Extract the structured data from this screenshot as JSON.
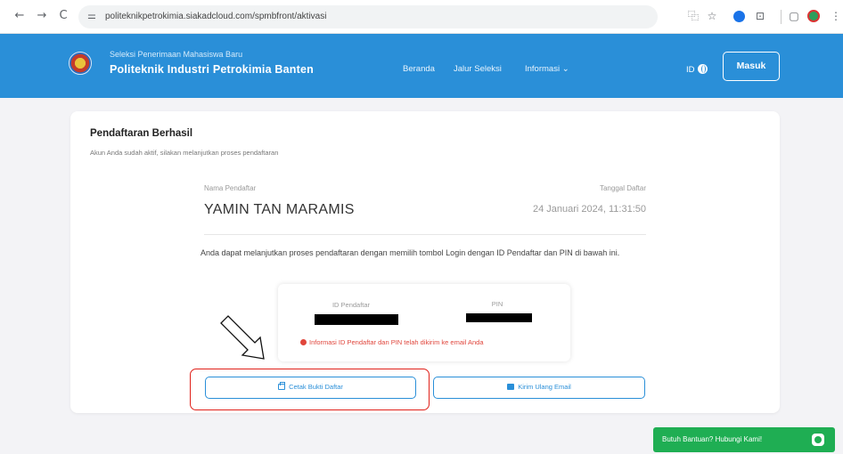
{
  "browser": {
    "url": "politeknikpetrokimia.siakadcloud.com/spmbfront/aktivasi",
    "nav": {
      "back": "←",
      "forward": "→",
      "reload": "C",
      "site_info": "⚌"
    },
    "toolbar": {
      "translate": "⿻",
      "star": "☆",
      "extensions": "⊡",
      "sidepanel": "▢",
      "menu": "⋮"
    }
  },
  "header": {
    "subtitle": "Seleksi Penerimaan Mahasiswa Baru",
    "title": "Politeknik Industri Petrokimia Banten",
    "menu": [
      "Beranda",
      "Jalur Seleksi",
      "Informasi ⌄"
    ],
    "lang": "ID",
    "login_label": "Masuk",
    "color": "#2a8fd8"
  },
  "card": {
    "title": "Pendaftaran Berhasil",
    "subtitle": "Akun Anda sudah aktif, silakan melanjutkan proses pendaftaran",
    "name_label": "Nama Pendaftar",
    "name_value": "YAMIN TAN MARAMIS",
    "date_label": "Tanggal Daftar",
    "date_value": "24 Januari 2024, 11:31:50",
    "info_text": "Anda dapat melanjutkan proses pendaftaran dengan memilih tombol Login dengan ID Pendaftar dan PIN di bawah ini.",
    "id_label": "ID Pendaftar",
    "pin_label": "PIN",
    "notice": "Informasi ID Pendaftar dan PIN telah dikirim ke email Anda",
    "print_button": "Cetak Bukti Daftar",
    "email_button": "Kirim Ulang Email"
  },
  "help": {
    "label": "Butuh Bantuan? Hubungi Kami!"
  }
}
